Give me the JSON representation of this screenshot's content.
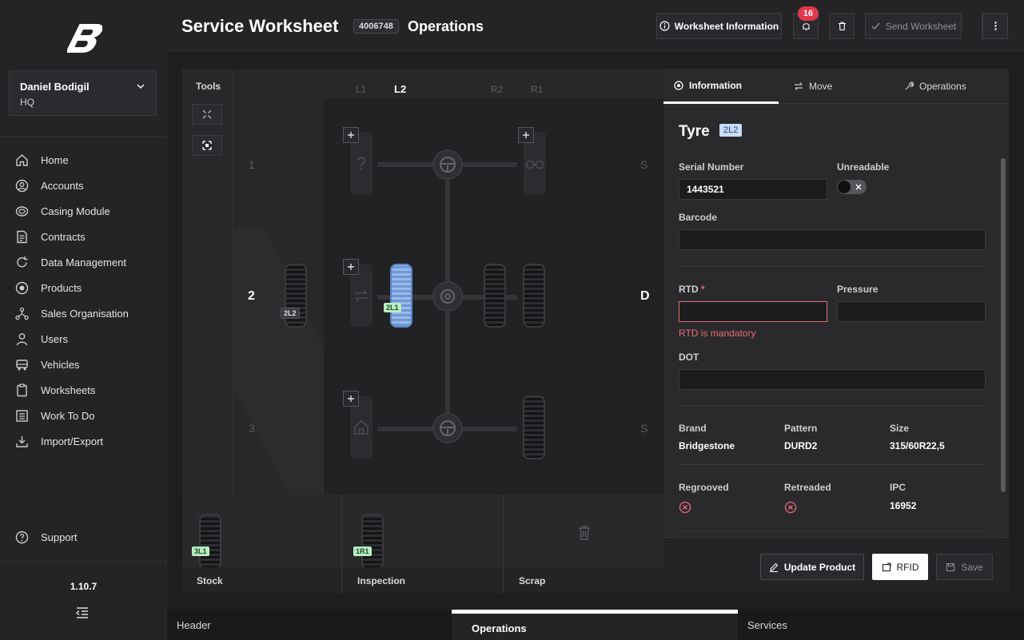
{
  "sidebar": {
    "user": {
      "name": "Daniel Bodigil",
      "org": "HQ"
    },
    "nav": [
      {
        "label": "Home",
        "icon": "home-icon"
      },
      {
        "label": "Accounts",
        "icon": "user-circle-icon"
      },
      {
        "label": "Casing Module",
        "icon": "casing-icon"
      },
      {
        "label": "Contracts",
        "icon": "contract-icon"
      },
      {
        "label": "Data Management",
        "icon": "refresh-icon"
      },
      {
        "label": "Products",
        "icon": "tyre-icon"
      },
      {
        "label": "Sales Organisation",
        "icon": "network-icon"
      },
      {
        "label": "Users",
        "icon": "user-icon"
      },
      {
        "label": "Vehicles",
        "icon": "truck-icon"
      },
      {
        "label": "Worksheets",
        "icon": "clipboard-icon"
      },
      {
        "label": "Work To Do",
        "icon": "list-icon"
      },
      {
        "label": "Import/Export",
        "icon": "download-icon"
      }
    ],
    "support": "Support",
    "version": "1.10.7"
  },
  "header": {
    "title": "Service Worksheet",
    "worksheet_id": "4006748",
    "section": "Operations",
    "info_button": "Worksheet Information",
    "notifications": "16",
    "send_button": "Send Worksheet"
  },
  "tools": {
    "label": "Tools"
  },
  "vehicle": {
    "columns": {
      "l1": "L1",
      "l2": "L2",
      "r2": "R2",
      "r1": "R1"
    },
    "rows": {
      "r1": "1",
      "r2": "2",
      "r3": "3"
    },
    "side_labels": {
      "s1": "S",
      "d": "D",
      "s3": "S"
    },
    "tags": {
      "loose": "2L2",
      "selected": "2L1"
    }
  },
  "bins": {
    "stock": {
      "label": "Stock",
      "tag": "3L1"
    },
    "inspection": {
      "label": "Inspection",
      "tag": "1R1"
    },
    "scrap": {
      "label": "Scrap"
    }
  },
  "panel": {
    "tabs": {
      "information": "Information",
      "move": "Move",
      "operations": "Operations"
    },
    "heading": "Tyre",
    "position": "2L2",
    "serial_label": "Serial Number",
    "serial_value": "1443521",
    "unreadable_label": "Unreadable",
    "barcode_label": "Barcode",
    "barcode_value": "",
    "rtd_label": "RTD",
    "rtd_required": "*",
    "rtd_value": "",
    "rtd_error": "RTD is mandatory",
    "pressure_label": "Pressure",
    "pressure_value": "",
    "dot_label": "DOT",
    "dot_value": "",
    "brand_label": "Brand",
    "brand": "Bridgestone",
    "pattern_label": "Pattern",
    "pattern": "DURD2",
    "size_label": "Size",
    "size": "315/60R22,5",
    "regrooved_label": "Regrooved",
    "retreaded_label": "Retreaded",
    "ipc_label": "IPC",
    "ipc": "16952",
    "buttons": {
      "update": "Update Product",
      "rfid": "RFID",
      "save": "Save"
    }
  },
  "bottom_tabs": {
    "header": "Header",
    "operations": "Operations",
    "services": "Services"
  },
  "colors": {
    "accent_error": "#e86b7a",
    "badge": "#e0384a",
    "selected_tyre": "#8fb1e6",
    "tag_green": "#b8ecc0"
  }
}
